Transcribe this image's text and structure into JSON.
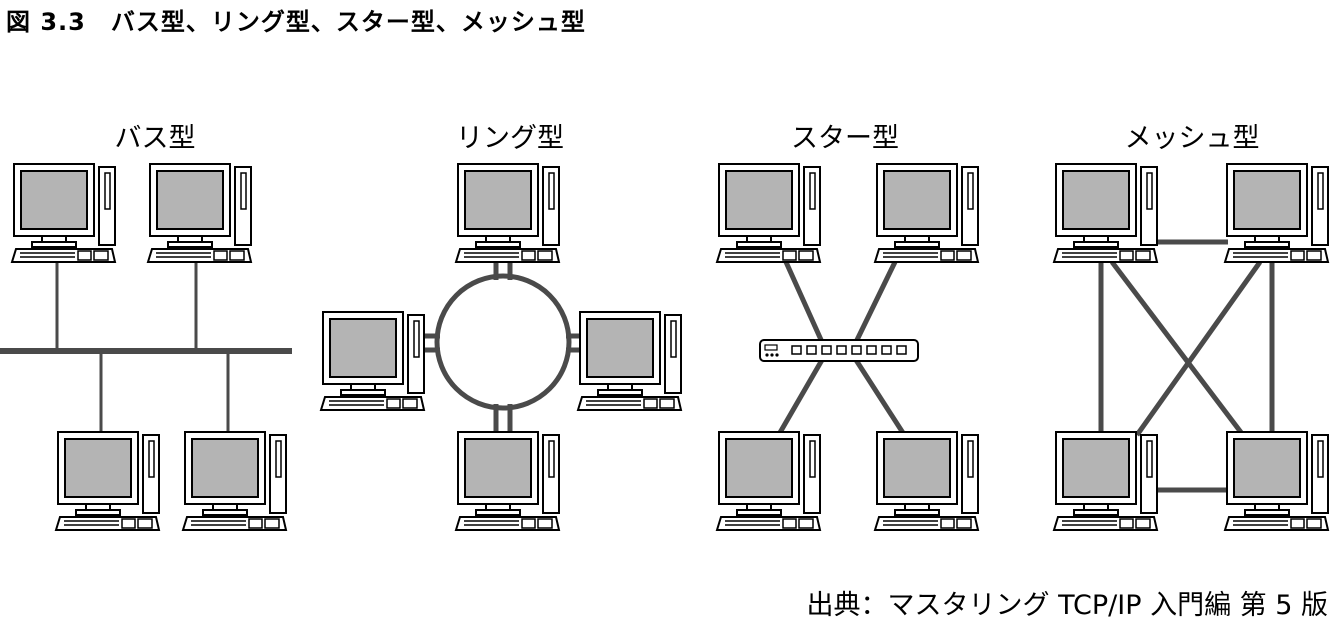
{
  "figure": {
    "caption": "図 3.3　バス型、リング型、スター型、メッシュ型",
    "source": "出典：マスタリング TCP/IP 入門編 第 5 版"
  },
  "topologies": [
    {
      "id": "bus",
      "label": "バス型"
    },
    {
      "id": "ring",
      "label": "リング型"
    },
    {
      "id": "star",
      "label": "スター型"
    },
    {
      "id": "mesh",
      "label": "メッシュ型"
    }
  ],
  "computer_icon": "desktop-computer-icon",
  "hub_icon": "network-switch-icon",
  "colors": {
    "line": "#4a4a4a",
    "screen": "#b4b4b4",
    "outline": "#000000",
    "body": "#ffffff"
  }
}
